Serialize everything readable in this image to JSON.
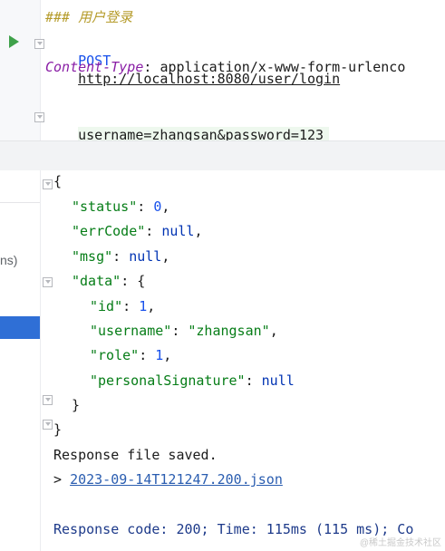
{
  "request": {
    "comment": "### 用户登录",
    "method": "POST",
    "url": "http://localhost:8080/user/login",
    "header_name": "Content-Type",
    "header_sep": ": ",
    "header_value": "application/x-www-form-urlenco",
    "body": "username=zhangsan&password=123"
  },
  "left_panel": {
    "label_fragment": "ns)"
  },
  "response": {
    "open_brace": "{",
    "status_key": "\"status\"",
    "status_val": "0",
    "errcode_key": "\"errCode\"",
    "errcode_val": "null",
    "msg_key": "\"msg\"",
    "msg_val": "null",
    "data_key": "\"data\"",
    "id_key": "\"id\"",
    "id_val": "1",
    "username_key": "\"username\"",
    "username_val": "\"zhangsan\"",
    "role_key": "\"role\"",
    "role_val": "1",
    "sig_key": "\"personalSignature\"",
    "sig_val": "null",
    "inner_close": "}",
    "outer_close": "}",
    "saved_msg": "Response file saved.",
    "file_prefix": "> ",
    "file_name": "2023-09-14T121247.200.json",
    "code_line": "Response code: 200; Time: 115ms (115 ms); Co"
  },
  "watermark": "@稀土掘金技术社区",
  "colors": {
    "run": "#3fa14a",
    "selection": "#2f6fd6",
    "body_highlight": "#eef8ee"
  }
}
